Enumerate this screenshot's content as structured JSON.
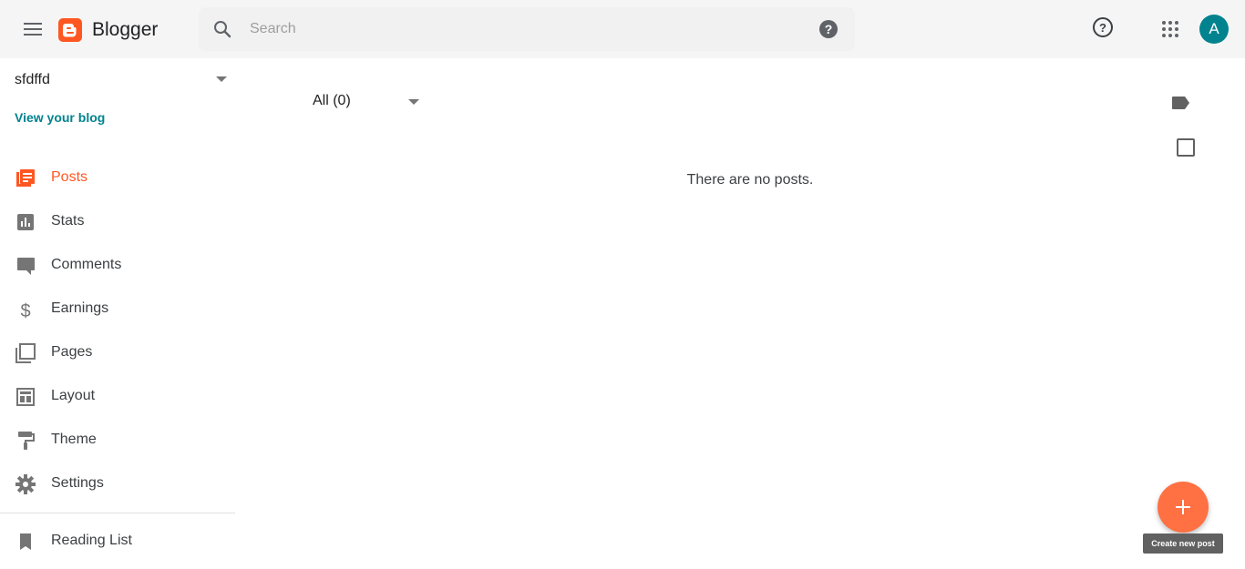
{
  "header": {
    "brand": "Blogger",
    "search_placeholder": "Search",
    "avatar_letter": "A",
    "colors": {
      "logo": "#ff5722",
      "avatar": "#00838f",
      "topbar": "#f5f5f5"
    }
  },
  "sidebar": {
    "blog_name": "sfdffd",
    "view_blog": "View your blog",
    "items": [
      {
        "label": "Posts",
        "icon": "posts-icon",
        "active": true
      },
      {
        "label": "Stats",
        "icon": "stats-icon",
        "active": false
      },
      {
        "label": "Comments",
        "icon": "comments-icon",
        "active": false
      },
      {
        "label": "Earnings",
        "icon": "dollar-icon",
        "active": false
      },
      {
        "label": "Pages",
        "icon": "pages-icon",
        "active": false
      },
      {
        "label": "Layout",
        "icon": "layout-icon",
        "active": false
      },
      {
        "label": "Theme",
        "icon": "paint-roller-icon",
        "active": false
      },
      {
        "label": "Settings",
        "icon": "gear-icon",
        "active": false
      }
    ],
    "reading_list": "Reading List"
  },
  "main": {
    "filter_label": "All (0)",
    "empty_message": "There are no posts.",
    "fab_tooltip": "Create new post",
    "colors": {
      "accent": "#ff5722",
      "fab": "#ff7043"
    }
  }
}
